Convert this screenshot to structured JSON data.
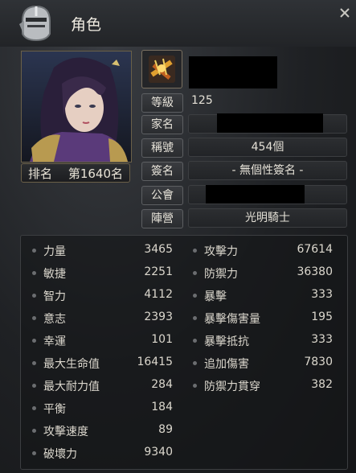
{
  "window": {
    "title": "角色"
  },
  "rank": {
    "label": "排名",
    "value": "第1640名"
  },
  "info": {
    "level_label": "等級",
    "level_value": "125",
    "family_label": "家名",
    "nick_label": "稱號",
    "nick_value": "454個",
    "sign_label": "簽名",
    "sign_value": "- 無個性簽名 -",
    "guild_label": "公會",
    "camp_label": "陣營",
    "camp_value": "光明騎士"
  },
  "stats_left": [
    {
      "name": "力量",
      "value": "3465"
    },
    {
      "name": "敏捷",
      "value": "2251"
    },
    {
      "name": "智力",
      "value": "4112"
    },
    {
      "name": "意志",
      "value": "2393"
    },
    {
      "name": "幸運",
      "value": "101"
    },
    {
      "name": "最大生命值",
      "value": "16415"
    },
    {
      "name": "最大耐力值",
      "value": "284"
    },
    {
      "name": "平衡",
      "value": "184"
    },
    {
      "name": "攻擊速度",
      "value": "89"
    },
    {
      "name": "破壞力",
      "value": "9340"
    }
  ],
  "stats_right": [
    {
      "name": "攻擊力",
      "value": "67614"
    },
    {
      "name": "防禦力",
      "value": "36380"
    },
    {
      "name": "暴擊",
      "value": "333"
    },
    {
      "name": "暴擊傷害量",
      "value": "195"
    },
    {
      "name": "暴擊抵抗",
      "value": "333"
    },
    {
      "name": "追加傷害",
      "value": "7830"
    },
    {
      "name": "防禦力貫穿",
      "value": "382"
    }
  ],
  "colors": {
    "frame_gold": "#6b6048",
    "text": "#d9d6cf"
  }
}
